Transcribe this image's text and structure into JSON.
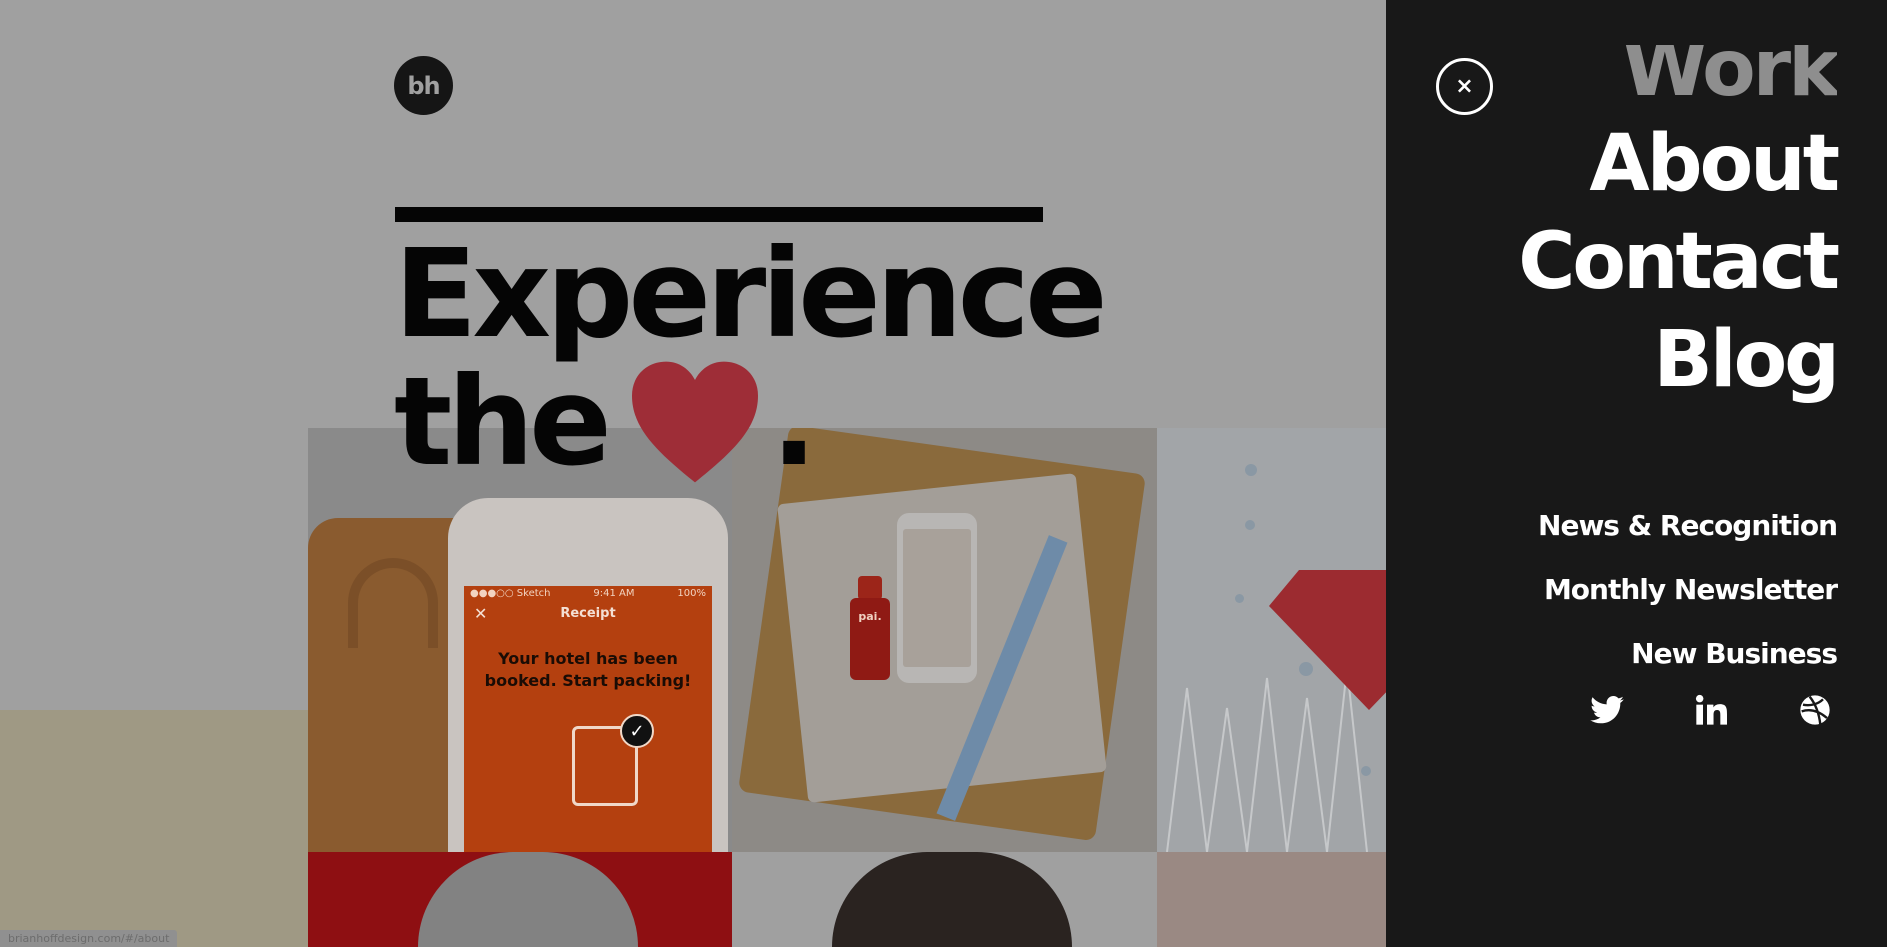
{
  "logo": {
    "text": "bh"
  },
  "hero": {
    "line1": "Experience",
    "line2_start": "the",
    "line2_end": "."
  },
  "receipt_app": {
    "status_left": "●●●○○ Sketch",
    "status_time": "9:41 AM",
    "status_battery": "100%",
    "title": "Receipt",
    "message_line1": "Your hotel has been",
    "message_line2": "booked. Start packing!"
  },
  "product": {
    "bottle_label": "pai."
  },
  "status_bar": {
    "url": "brianhoffdesign.com/#/about"
  },
  "menu": {
    "close_label": "×",
    "primary": [
      {
        "label": "Work"
      },
      {
        "label": "About"
      },
      {
        "label": "Contact"
      },
      {
        "label": "Blog"
      }
    ],
    "secondary": [
      {
        "label": "News & Recognition"
      },
      {
        "label": "Monthly Newsletter"
      },
      {
        "label": "New Business"
      }
    ],
    "social_icons": [
      "twitter-icon",
      "linkedin-icon",
      "dribbble-icon"
    ]
  },
  "colors": {
    "menu_bg": "#181818",
    "heart": "#9e2d37",
    "page_dim": "#a0a0a0"
  }
}
